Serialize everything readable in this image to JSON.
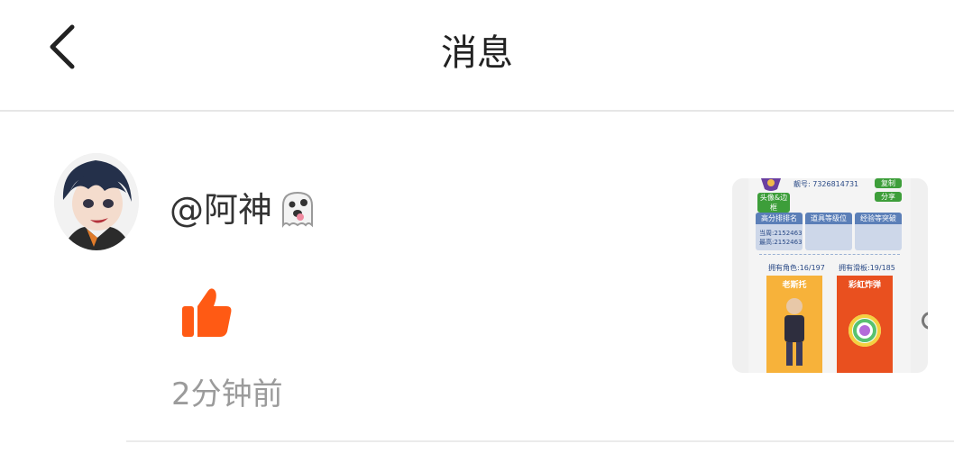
{
  "header": {
    "title": "消息"
  },
  "message": {
    "username": "@阿神",
    "time": "2分钟前"
  },
  "thumbnail": {
    "id_label": "靓号: 7326814731",
    "btn_tl": "头像&边框",
    "btn_tr": "复制",
    "btn_share": "分享",
    "panels": [
      "高分排排名",
      "道具等级位",
      "经验等突破"
    ],
    "panel_lines": [
      "当周:2152463",
      "最高:2152463"
    ],
    "owned_left": "拥有角色:16/197",
    "owned_right": "拥有滑板:19/185",
    "card_left": "老斯托",
    "card_right": "彩虹炸弹"
  },
  "colors": {
    "like": "#ff5a14",
    "card_left": "#f7b23a",
    "card_right": "#e9501f"
  }
}
